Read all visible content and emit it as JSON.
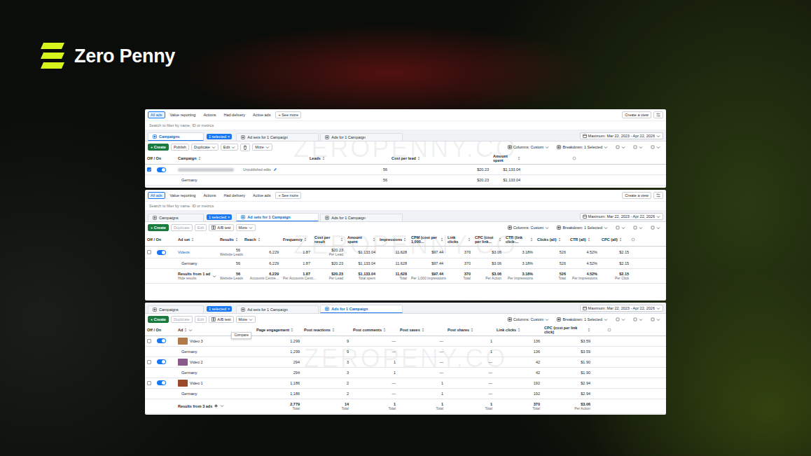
{
  "brand": {
    "name": "Zero Penny"
  },
  "panels": [
    {
      "watermark": "ZEROPENNY.CO",
      "toolbar": {
        "filters": [
          {
            "label": "All ads",
            "selected": true
          },
          {
            "label": "Value reporting",
            "selected": false
          },
          {
            "label": "Actions",
            "selected": false
          },
          {
            "label": "Had delivery",
            "selected": false
          },
          {
            "label": "Active ads",
            "selected": false
          },
          {
            "label": "+ See more",
            "selected": false
          }
        ],
        "create_view": "Create a view"
      },
      "search": {
        "placeholder": "Search to filter by name, ID or metrics"
      },
      "nav": {
        "items": [
          {
            "label": "Campaigns",
            "kind": "tab",
            "selected": true
          },
          {
            "label": "1 selected",
            "kind": "chip",
            "close": "×",
            "selected": false
          },
          {
            "label": "Ad sets for 1 Campaign",
            "kind": "tab",
            "selected": false
          },
          {
            "label": "Ads for 1 Campaign",
            "kind": "tab",
            "selected": false
          }
        ],
        "date": "Maximum: Mar 22, 2023 - Apr 22, 2026"
      },
      "actions": {
        "left": [
          {
            "label": "+ Create",
            "kind": "primary",
            "disabled": false
          },
          {
            "label": "Publish",
            "kind": "button",
            "disabled": false
          },
          {
            "label": "Duplicate",
            "kind": "split",
            "disabled": false
          },
          {
            "label": "Edit",
            "kind": "split",
            "disabled": false
          },
          {
            "kind": "delete",
            "disabled": false
          },
          {
            "label": "More",
            "kind": "menu",
            "disabled": false
          }
        ],
        "right": [
          {
            "label": "Columns: Custom"
          },
          {
            "label": "Breakdown: 1 Selected"
          }
        ]
      },
      "table": {
        "columns": [
          "Off / On",
          "Campaign",
          "Leads",
          "Cost per lead",
          "Amount spent"
        ],
        "rows": [
          {
            "kind": "item",
            "checked": true,
            "on": true,
            "name_redacted": true,
            "badge": "Unpublished edits",
            "cells": [
              "56",
              "$20.23",
              "$1,133.04"
            ]
          },
          {
            "kind": "breakdown",
            "name": "Germany",
            "cells": [
              "56",
              "$20.23",
              "$1,133.04"
            ]
          }
        ]
      }
    },
    {
      "watermark": "ZEROPENNY.CO",
      "toolbar": {
        "filters": [
          {
            "label": "All ads",
            "selected": true
          },
          {
            "label": "Value reporting",
            "selected": false
          },
          {
            "label": "Actions",
            "selected": false
          },
          {
            "label": "Had delivery",
            "selected": false
          },
          {
            "label": "Active ads",
            "selected": false
          },
          {
            "label": "+ See more",
            "selected": false
          }
        ],
        "create_view": "Create a view"
      },
      "search": {
        "placeholder": "Search to filter by name, ID or metrics"
      },
      "nav": {
        "items": [
          {
            "label": "Campaigns",
            "kind": "tab",
            "selected": false
          },
          {
            "label": "1 selected",
            "kind": "chip",
            "close": "×",
            "selected": false
          },
          {
            "label": "Ad sets for 1 Campaign",
            "kind": "tab",
            "selected": true
          },
          {
            "label": "Ads for 1 Campaign",
            "kind": "tab",
            "selected": false
          }
        ],
        "date": "Maximum: Mar 22, 2023 - Apr 22, 2026"
      },
      "actions": {
        "left": [
          {
            "label": "+ Create",
            "kind": "primary",
            "disabled": false
          },
          {
            "label": "Duplicate",
            "kind": "button",
            "disabled": true
          },
          {
            "label": "Edit",
            "kind": "button",
            "disabled": true
          },
          {
            "label": "A/B test",
            "kind": "button",
            "disabled": false
          },
          {
            "label": "More",
            "kind": "menu",
            "disabled": false
          }
        ],
        "right": [
          {
            "label": "Columns: Custom"
          },
          {
            "label": "Breakdown: 1 Selected"
          }
        ]
      },
      "table": {
        "columns": [
          "Off / On",
          "Ad set",
          "Results",
          "Reach",
          "Frequency",
          "Cost per result",
          "Amount spent",
          "Impressions",
          "CPM (cost per 1,000...",
          "Link clicks",
          "CPC (cost per link...",
          "CTR (link click-...",
          "Clicks (all)",
          "CTR (all)",
          "CPC (all)"
        ],
        "rows": [
          {
            "kind": "item",
            "checked": false,
            "on": true,
            "name": "Videos",
            "cells": [
              {
                "value": "56",
                "sub": "Website Leads"
              },
              "6,229",
              "1.87",
              {
                "value": "$20.23",
                "sub": "Per Lead"
              },
              "$1,133.04",
              "11,628",
              "$97.44",
              "370",
              "$3.06",
              "3.18%",
              "526",
              "4.52%",
              "$2.15"
            ]
          },
          {
            "kind": "breakdown",
            "name": "Germany",
            "cells": [
              "56",
              "6,229",
              "1.87",
              "$20.23",
              "$1,133.04",
              "11,628",
              "$97.44",
              "370",
              "$3.06",
              "3.18%",
              "526",
              "4.52%",
              "$2.15"
            ]
          },
          {
            "kind": "total",
            "name": "Results from 1 ad",
            "sub": "Hide results",
            "cells": [
              {
                "value": "56",
                "sub": "Website Leads"
              },
              {
                "value": "6,229",
                "sub": "Accounts Centre..."
              },
              {
                "value": "1.87",
                "sub": "Per Accounts Centr..."
              },
              {
                "value": "$20.23",
                "sub": "Per Lead"
              },
              {
                "value": "$1,133.04",
                "sub": "Total spent"
              },
              {
                "value": "11,628",
                "sub": "Total"
              },
              {
                "value": "$97.44",
                "sub": "Per 1,000 Impressions"
              },
              {
                "value": "370",
                "sub": "Total"
              },
              {
                "value": "$3.06",
                "sub": "Per Action"
              },
              {
                "value": "3.18%",
                "sub": "Per Impressions"
              },
              {
                "value": "526",
                "sub": "Total"
              },
              {
                "value": "4.52%",
                "sub": "Per Impressions"
              },
              {
                "value": "$2.15",
                "sub": "Per Click"
              }
            ]
          }
        ]
      }
    },
    {
      "watermark": "ZEROPENY.CO",
      "nav": {
        "items": [
          {
            "label": "Campaigns",
            "kind": "tab",
            "selected": false
          },
          {
            "label": "1 selected",
            "kind": "chip",
            "close": "×",
            "selected": false
          },
          {
            "label": "Ad sets for 1 Campaign",
            "kind": "tab",
            "selected": false
          },
          {
            "label": "Ads for 1 Campaign",
            "kind": "tab",
            "selected": true
          }
        ],
        "date": "Maximum: Mar 22, 2023 - Apr 22, 2026"
      },
      "actions": {
        "left": [
          {
            "label": "+ Create",
            "kind": "primary",
            "disabled": false
          },
          {
            "label": "Duplicate",
            "kind": "button",
            "disabled": true
          },
          {
            "label": "Edit",
            "kind": "button",
            "disabled": true
          },
          {
            "label": "A/B test",
            "kind": "button",
            "disabled": false
          },
          {
            "label": "More",
            "kind": "menu",
            "disabled": false
          }
        ],
        "right": [
          {
            "label": "Columns: Custom"
          },
          {
            "label": "Breakdown: 1 Selected"
          }
        ]
      },
      "table": {
        "columns": [
          "Off / On",
          "Ad",
          "Page engagement",
          "Post reactions",
          "Post comments",
          "Post saves",
          "Post shares",
          "Link clicks",
          "CPC (cost per link click)"
        ],
        "tooltip": "Compare",
        "rows": [
          {
            "kind": "item",
            "checked": false,
            "on": true,
            "name": "Video 3",
            "thumb": "#b07a4a",
            "cells": [
              "1,299",
              "9",
              "—",
              "—",
              "1",
              "136",
              "$3.59"
            ]
          },
          {
            "kind": "breakdown",
            "name": "Germany",
            "cells": [
              "1,299",
              "9",
              "—",
              "—",
              "1",
              "136",
              "$3.59"
            ]
          },
          {
            "kind": "item",
            "checked": false,
            "on": true,
            "name": "Video 2",
            "thumb": "#8a5a8c",
            "cells": [
              "294",
              "3",
              "1",
              "—",
              "—",
              "42",
              "$1.90"
            ]
          },
          {
            "kind": "breakdown",
            "name": "Germany",
            "cells": [
              "294",
              "3",
              "1",
              "—",
              "—",
              "42",
              "$1.90"
            ]
          },
          {
            "kind": "item",
            "checked": false,
            "on": true,
            "name": "Video 1",
            "thumb": "#9a4a2a",
            "cells": [
              "1,186",
              "2",
              "—",
              "1",
              "—",
              "192",
              "$2.94"
            ]
          },
          {
            "kind": "breakdown",
            "name": "Germany",
            "cells": [
              "1,186",
              "2",
              "—",
              "1",
              "—",
              "192",
              "$2.94"
            ]
          },
          {
            "kind": "total",
            "name": "Results from 3 ads",
            "cells": [
              {
                "value": "2,779",
                "sub": "Total"
              },
              {
                "value": "14",
                "sub": "Total"
              },
              {
                "value": "1",
                "sub": "Total"
              },
              {
                "value": "1",
                "sub": "Total"
              },
              {
                "value": "1",
                "sub": "Total"
              },
              {
                "value": "370",
                "sub": "Total"
              },
              {
                "value": "$3.06",
                "sub": "Per Action"
              }
            ]
          }
        ]
      }
    }
  ]
}
